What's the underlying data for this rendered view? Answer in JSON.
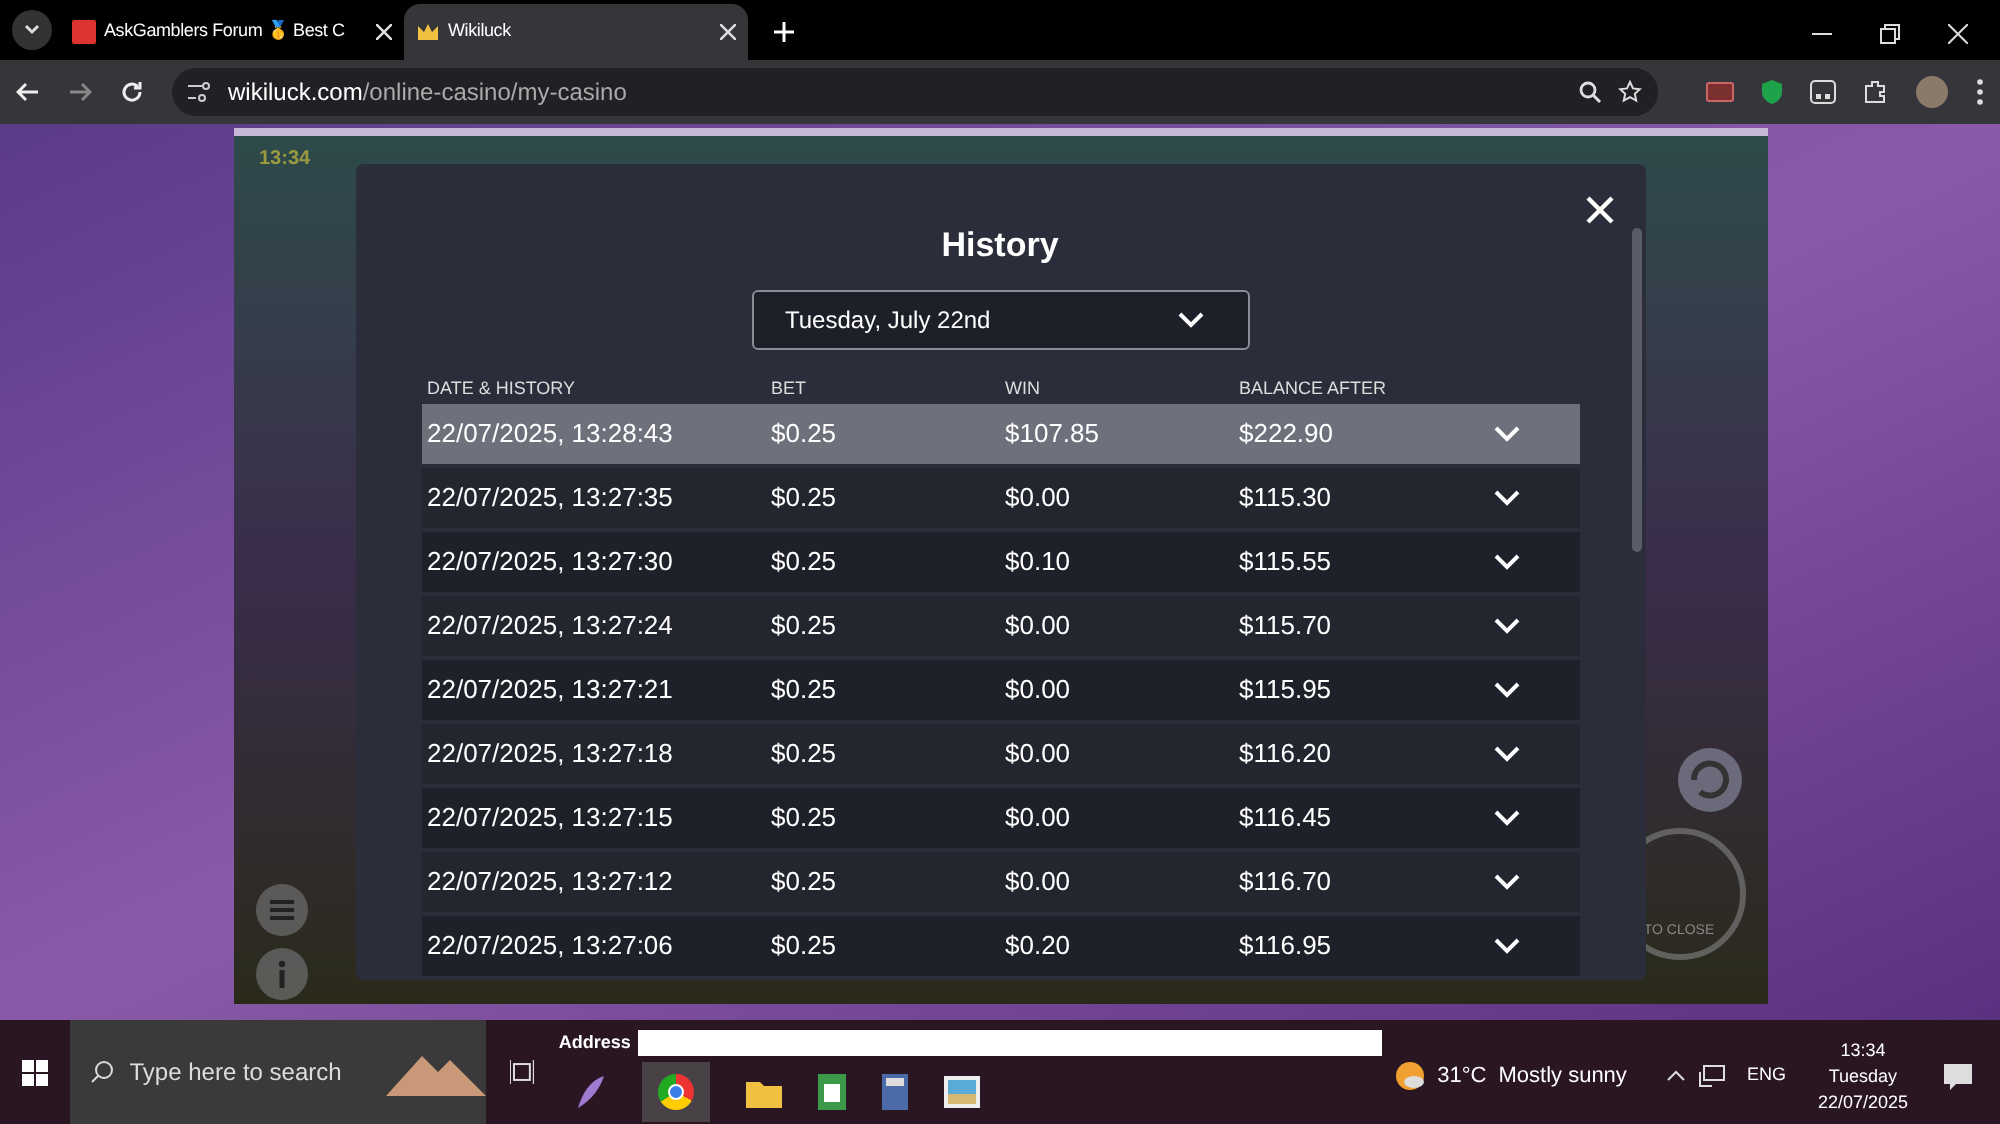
{
  "browser": {
    "tabs": [
      {
        "title": "AskGamblers Forum 🥇 Best C",
        "selected": false
      },
      {
        "title": "Wikiluck",
        "selected": true
      }
    ],
    "url_domain": "wikiluck.com",
    "url_path": "/online-casino/my-casino"
  },
  "game": {
    "clock": "13:34",
    "hint": "TO CLOSE"
  },
  "history": {
    "title": "History",
    "date": "Tuesday, July 22nd",
    "columns": [
      "DATE & HISTORY",
      "BET",
      "WIN",
      "BALANCE AFTER"
    ],
    "rows": [
      {
        "date": "22/07/2025, 13:28:43",
        "bet": "$0.25",
        "win": "$107.85",
        "balance": "$222.90",
        "selected": true
      },
      {
        "date": "22/07/2025, 13:27:35",
        "bet": "$0.25",
        "win": "$0.00",
        "balance": "$115.30",
        "selected": false
      },
      {
        "date": "22/07/2025, 13:27:30",
        "bet": "$0.25",
        "win": "$0.10",
        "balance": "$115.55",
        "selected": false
      },
      {
        "date": "22/07/2025, 13:27:24",
        "bet": "$0.25",
        "win": "$0.00",
        "balance": "$115.70",
        "selected": false
      },
      {
        "date": "22/07/2025, 13:27:21",
        "bet": "$0.25",
        "win": "$0.00",
        "balance": "$115.95",
        "selected": false
      },
      {
        "date": "22/07/2025, 13:27:18",
        "bet": "$0.25",
        "win": "$0.00",
        "balance": "$116.20",
        "selected": false
      },
      {
        "date": "22/07/2025, 13:27:15",
        "bet": "$0.25",
        "win": "$0.00",
        "balance": "$116.45",
        "selected": false
      },
      {
        "date": "22/07/2025, 13:27:12",
        "bet": "$0.25",
        "win": "$0.00",
        "balance": "$116.70",
        "selected": false
      },
      {
        "date": "22/07/2025, 13:27:06",
        "bet": "$0.25",
        "win": "$0.20",
        "balance": "$116.95",
        "selected": false
      }
    ]
  },
  "taskbar": {
    "search_placeholder": "Type here to search",
    "address_label": "Address",
    "weather": "31°C",
    "weather_text": "Mostly sunny",
    "language": "ENG",
    "time": "13:34",
    "day": "Tuesday",
    "date": "22/07/2025"
  }
}
